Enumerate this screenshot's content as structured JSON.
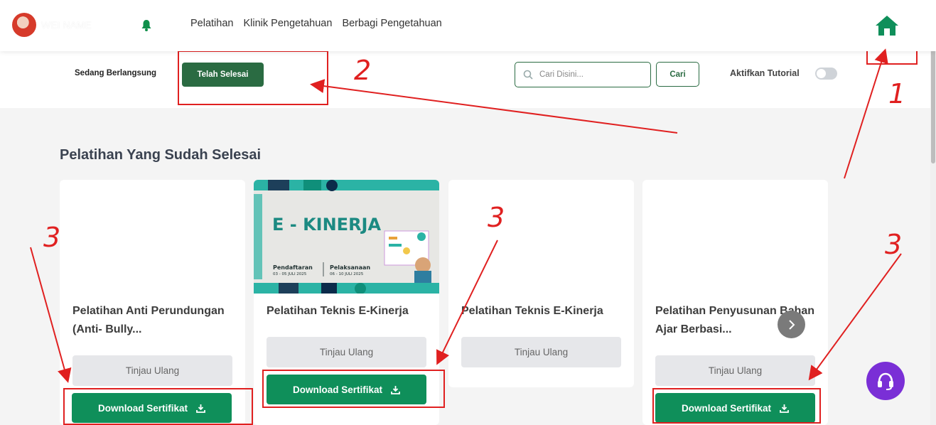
{
  "header": {
    "username": "WEI NAME",
    "nav": [
      "Pelatihan",
      "Klinik Pengetahuan",
      "Berbagi Pengetahuan"
    ]
  },
  "tabs": {
    "ongoing": "Sedang Berlangsung",
    "done": "Telah Selesai"
  },
  "search": {
    "placeholder": "Cari Disini...",
    "button": "Cari"
  },
  "tutorial": {
    "label": "Aktifkan Tutorial",
    "enabled": false
  },
  "section_title": "Pelatihan Yang Sudah Selesai",
  "banner": {
    "headline": "E - KINERJA",
    "reg_label": "Pendaftaran",
    "reg_date": "03 - 05 JULI 2025",
    "exec_label": "Pelaksanaan",
    "exec_date": "06 - 10 JULI 2025"
  },
  "cards": [
    {
      "title": "Pelatihan Anti Perundungan (Anti- Bully...",
      "review": "Tinjau Ulang",
      "download": "Download Sertifikat"
    },
    {
      "title": "Pelatihan Teknis E-Kinerja",
      "review": "Tinjau Ulang",
      "download": "Download Sertifikat"
    },
    {
      "title": "Pelatihan Teknis E-Kinerja",
      "review": "Tinjau Ulang"
    },
    {
      "title": "Pelatihan Penyusunan Bahan Ajar Berbasi...",
      "review": "Tinjau Ulang",
      "download": "Download Sertifikat"
    }
  ],
  "annotations": [
    "1",
    "2",
    "3",
    "3",
    "3"
  ],
  "colors": {
    "primary_green": "#2a6b42",
    "download_green": "#0f8f5a",
    "help_purple": "#7a2fd6",
    "annotation_red": "#e02020"
  }
}
